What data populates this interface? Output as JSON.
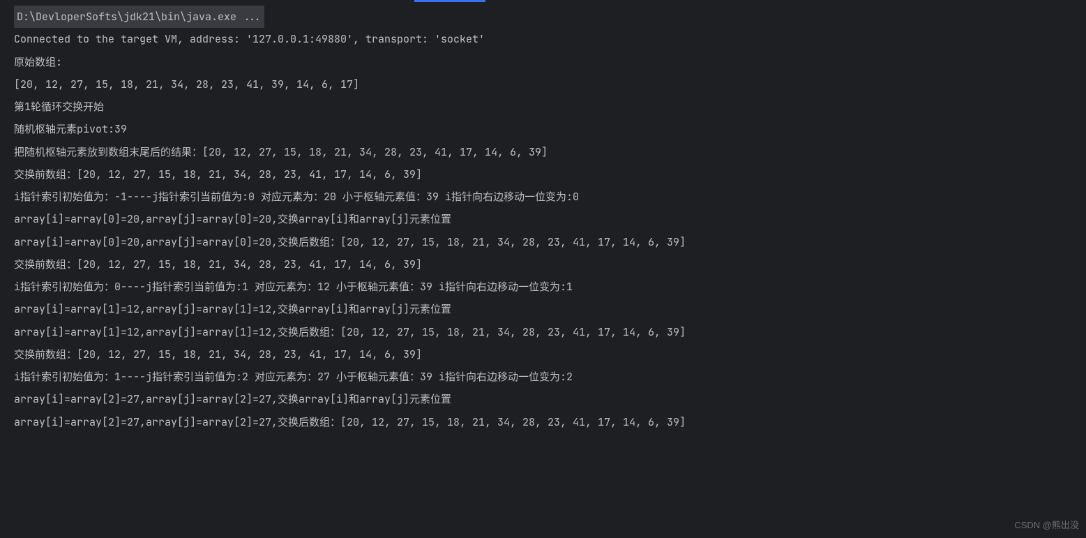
{
  "cmdLine": "D:\\DevloperSofts\\jdk21\\bin\\java.exe ...",
  "lines": [
    "Connected to the target VM, address: '127.0.0.1:49880', transport: 'socket'",
    "原始数组:",
    "[20, 12, 27, 15, 18, 21, 34, 28, 23, 41, 39, 14, 6, 17]",
    "",
    "第1轮循环交换开始",
    "随机枢轴元素pivot:39",
    "把随机枢轴元素放到数组末尾后的结果：[20, 12, 27, 15, 18, 21, 34, 28, 23, 41, 17, 14, 6, 39]",
    "",
    "交换前数组：[20, 12, 27, 15, 18, 21, 34, 28, 23, 41, 17, 14, 6, 39]",
    "i指针索引初始值为：-1----j指针索引当前值为:0 对应元素为：20 小于枢轴元素值：39 i指针向右边移动一位变为:0",
    "array[i]=array[0]=20,array[j]=array[0]=20,交换array[i]和array[j]元素位置",
    "array[i]=array[0]=20,array[j]=array[0]=20,交换后数组：[20, 12, 27, 15, 18, 21, 34, 28, 23, 41, 17, 14, 6, 39]",
    "",
    "交换前数组：[20, 12, 27, 15, 18, 21, 34, 28, 23, 41, 17, 14, 6, 39]",
    "i指针索引初始值为：0----j指针索引当前值为:1 对应元素为：12 小于枢轴元素值：39 i指针向右边移动一位变为:1",
    "array[i]=array[1]=12,array[j]=array[1]=12,交换array[i]和array[j]元素位置",
    "array[i]=array[1]=12,array[j]=array[1]=12,交换后数组：[20, 12, 27, 15, 18, 21, 34, 28, 23, 41, 17, 14, 6, 39]",
    "",
    "交换前数组：[20, 12, 27, 15, 18, 21, 34, 28, 23, 41, 17, 14, 6, 39]",
    "i指针索引初始值为：1----j指针索引当前值为:2 对应元素为：27 小于枢轴元素值：39 i指针向右边移动一位变为:2",
    "array[i]=array[2]=27,array[j]=array[2]=27,交换array[i]和array[j]元素位置",
    "array[i]=array[2]=27,array[j]=array[2]=27,交换后数组：[20, 12, 27, 15, 18, 21, 34, 28, 23, 41, 17, 14, 6, 39]"
  ],
  "watermark": "CSDN @熊出没"
}
